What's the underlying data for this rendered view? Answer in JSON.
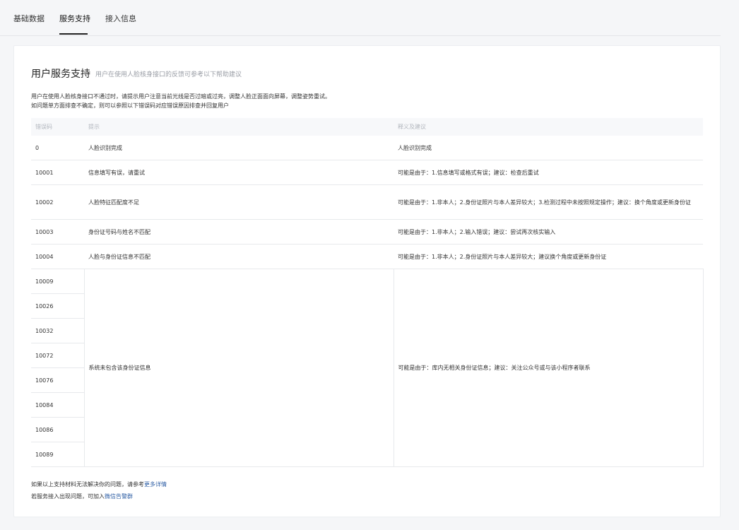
{
  "tabs": [
    {
      "label": "基础数据"
    },
    {
      "label": "服务支持"
    },
    {
      "label": "接入信息"
    }
  ],
  "section": {
    "title": "用户服务支持",
    "subtitle": "用户在使用人脸核身接口的反馈可参考以下帮助建议"
  },
  "intro": {
    "line1": "用户在使用人脸核身接口不通过时，请提示用户注意当前光线是否过暗或过亮，调整人脸正面面向屏幕，调整姿势重试。",
    "line2": "如问题单方面排查不确定，则可以参照以下错误码对应错误原因排查并回复用户"
  },
  "table": {
    "headers": {
      "code": "错误码",
      "hint": "提示",
      "advice": "释义及建议"
    },
    "rows": [
      {
        "code": "0",
        "hint": "人脸识别完成",
        "advice": "人脸识别完成"
      },
      {
        "code": "10001",
        "hint": "信息填写有误，请重试",
        "advice": "可能是由于：1.信息填写或格式有误；建议：检查后重试"
      },
      {
        "code": "10002",
        "hint": "人脸特征匹配度不足",
        "advice": "可能是由于：1.非本人；2.身份证照片与本人差异较大；3.检测过程中未按照规定操作；建议：换个角度或更新身份证"
      },
      {
        "code": "10003",
        "hint": "身份证号码与姓名不匹配",
        "advice": "可能是由于：1.非本人；2.输入错误；建议：尝试再次核实输入"
      },
      {
        "code": "10004",
        "hint": "人脸与身份证信息不匹配",
        "advice": "可能是由于：1.非本人；2.身份证照片与本人差异较大；建议换个角度或更新身份证"
      }
    ],
    "group": {
      "codes": [
        "10009",
        "10026",
        "10032",
        "10072",
        "10076",
        "10084",
        "10086",
        "10089"
      ],
      "hint": "系统未包含该身份证信息",
      "advice": "可能是由于：库内无相关身份证信息；建议：关注公众号或与该小程序者联系"
    }
  },
  "footer": {
    "line1_text": "如果以上支持材料无法解决你的问题，请参考",
    "line1_link": "更多详情",
    "line2_text": "若服务接入出现问题，可加入",
    "line2_link": "微信告警群"
  }
}
